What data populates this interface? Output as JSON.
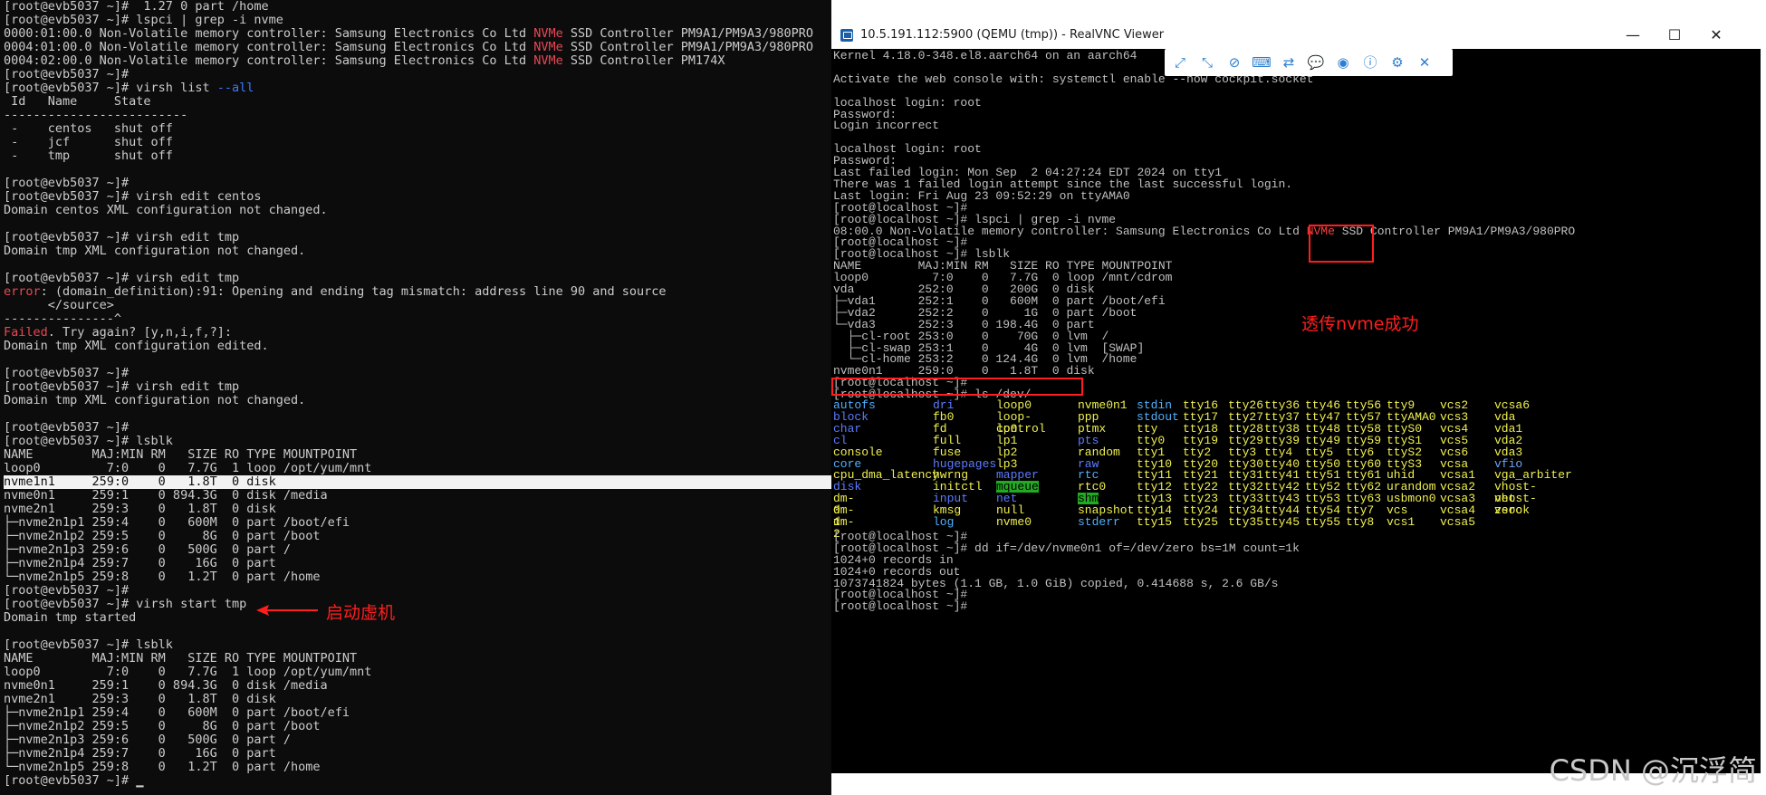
{
  "left_terminal": {
    "lines": [
      {
        "text": "[root@evb5037 ~]#  1.27 0 part /home"
      },
      {
        "text": "[root@evb5037 ~]# lspci | grep -i nvme"
      },
      {
        "pre": "0000:01:00.0 Non-Volatile memory controller: Samsung Electronics Co Ltd ",
        "kw": "NVMe",
        "post": " SSD Controller PM9A1/PM9A3/980PRO",
        "kw_color": "red"
      },
      {
        "pre": "0004:01:00.0 Non-Volatile memory controller: Samsung Electronics Co Ltd ",
        "kw": "NVMe",
        "post": " SSD Controller PM9A1/PM9A3/980PRO",
        "kw_color": "red"
      },
      {
        "pre": "0004:02:00.0 Non-Volatile memory controller: Samsung Electronics Co Ltd ",
        "kw": "NVMe",
        "post": " SSD Controller PM174X",
        "kw_color": "red"
      },
      {
        "text": "[root@evb5037 ~]#"
      },
      {
        "pre": "[root@evb5037 ~]# virsh list ",
        "kw": "--all",
        "post": "",
        "kw_color": "blue"
      },
      {
        "text": " Id   Name     State"
      },
      {
        "text": "-------------------------"
      },
      {
        "text": " -    centos   shut off"
      },
      {
        "text": " -    jcf      shut off"
      },
      {
        "text": " -    tmp      shut off"
      },
      {
        "text": ""
      },
      {
        "text": "[root@evb5037 ~]#"
      },
      {
        "text": "[root@evb5037 ~]# virsh edit centos"
      },
      {
        "text": "Domain centos XML configuration not changed."
      },
      {
        "text": ""
      },
      {
        "text": "[root@evb5037 ~]# virsh edit tmp"
      },
      {
        "text": "Domain tmp XML configuration not changed."
      },
      {
        "text": ""
      },
      {
        "text": "[root@evb5037 ~]# virsh edit tmp"
      },
      {
        "pre": "",
        "kw": "error",
        "post": ": (domain_definition):91: Opening and ending tag mismatch: address line 90 and source",
        "kw_color": "red"
      },
      {
        "text": "      </source>"
      },
      {
        "text": "---------------^"
      },
      {
        "pre": "",
        "kw": "Failed",
        "post": ". Try again? [y,n,i,f,?]:",
        "kw_color": "red"
      },
      {
        "text": "Domain tmp XML configuration edited."
      },
      {
        "text": ""
      },
      {
        "text": "[root@evb5037 ~]#"
      },
      {
        "text": "[root@evb5037 ~]# virsh edit tmp"
      },
      {
        "text": "Domain tmp XML configuration not changed."
      },
      {
        "text": ""
      },
      {
        "text": "[root@evb5037 ~]#"
      },
      {
        "text": "[root@evb5037 ~]# lsblk"
      },
      {
        "text": "NAME        MAJ:MIN RM   SIZE RO TYPE MOUNTPOINT"
      },
      {
        "text": "loop0         7:0    0   7.7G  1 loop /opt/yum/mnt"
      },
      {
        "text": "nvme1n1     259:0    0   1.8T  0 disk",
        "highlight": true
      },
      {
        "text": "nvme0n1     259:1    0 894.3G  0 disk /media"
      },
      {
        "text": "nvme2n1     259:3    0   1.8T  0 disk"
      },
      {
        "text": "├─nvme2n1p1 259:4    0   600M  0 part /boot/efi"
      },
      {
        "text": "├─nvme2n1p2 259:5    0     8G  0 part /boot"
      },
      {
        "text": "├─nvme2n1p3 259:6    0   500G  0 part /"
      },
      {
        "text": "├─nvme2n1p4 259:7    0    16G  0 part"
      },
      {
        "text": "└─nvme2n1p5 259:8    0   1.2T  0 part /home"
      },
      {
        "text": "[root@evb5037 ~]#"
      },
      {
        "text": "[root@evb5037 ~]# virsh start tmp"
      },
      {
        "text": "Domain tmp started"
      },
      {
        "text": ""
      },
      {
        "text": "[root@evb5037 ~]# lsblk"
      },
      {
        "text": "NAME        MAJ:MIN RM   SIZE RO TYPE MOUNTPOINT"
      },
      {
        "text": "loop0         7:0    0   7.7G  1 loop /opt/yum/mnt"
      },
      {
        "text": "nvme0n1     259:1    0 894.3G  0 disk /media"
      },
      {
        "text": "nvme2n1     259:3    0   1.8T  0 disk"
      },
      {
        "text": "├─nvme2n1p1 259:4    0   600M  0 part /boot/efi"
      },
      {
        "text": "├─nvme2n1p2 259:5    0     8G  0 part /boot"
      },
      {
        "text": "├─nvme2n1p3 259:6    0   500G  0 part /"
      },
      {
        "text": "├─nvme2n1p4 259:7    0    16G  0 part"
      },
      {
        "text": "└─nvme2n1p5 259:8    0   1.2T  0 part /home"
      },
      {
        "text": "[root@evb5037 ~]# ▁"
      }
    ],
    "annotation_start_vm": "启动虚机"
  },
  "vnc": {
    "window_title": "10.5.191.112:5900 (QEMU (tmp)) - RealVNC Viewer",
    "minimize_glyph": "—",
    "maximize_glyph": "☐",
    "close_glyph": "✕",
    "toolbar": {
      "icons": [
        "expand-icon",
        "fit-icon",
        "pointer-off-icon",
        "ctrl-alt-del-icon",
        "transfer-icon",
        "chat-icon",
        "record-icon",
        "info-icon",
        "settings-icon",
        "close-toolbar-icon"
      ],
      "glyphs": [
        "⤢",
        "⤡",
        "⊘",
        "⌨",
        "⇄",
        "💬",
        "◉",
        "ⓘ",
        "⚙",
        "✕"
      ]
    },
    "screen_lines": [
      {
        "text": "Kernel 4.18.0-348.el8.aarch64 on an aarch64"
      },
      {
        "text": ""
      },
      {
        "text": "Activate the web console with: systemctl enable --now cockpit.socket"
      },
      {
        "text": ""
      },
      {
        "text": "localhost login: root"
      },
      {
        "text": "Password:"
      },
      {
        "text": "Login incorrect"
      },
      {
        "text": ""
      },
      {
        "text": "localhost login: root"
      },
      {
        "text": "Password:"
      },
      {
        "text": "Last failed login: Mon Sep  2 04:27:24 EDT 2024 on tty1"
      },
      {
        "text": "There was 1 failed login attempt since the last successful login."
      },
      {
        "text": "Last login: Fri Aug 23 09:52:29 on ttyAMA0"
      },
      {
        "text": "[root@localhost ~]#"
      },
      {
        "text": "[root@localhost ~]# lspci | grep -i nvme"
      },
      {
        "pre": "08:00.0 Non-Volatile memory controller: Samsung Electronics Co Ltd ",
        "kw": "NVMe",
        "post": " SSD Controller PM9A1/PM9A3/980PRO"
      },
      {
        "text": "[root@localhost ~]#"
      },
      {
        "text": "[root@localhost ~]# lsblk"
      },
      {
        "text": "NAME        MAJ:MIN RM   SIZE RO TYPE MOUNTPOINT"
      },
      {
        "text": "loop0         7:0    0   7.7G  0 loop /mnt/cdrom"
      },
      {
        "text": "vda         252:0    0   200G  0 disk"
      },
      {
        "text": "├─vda1      252:1    0   600M  0 part /boot/efi"
      },
      {
        "text": "├─vda2      252:2    0     1G  0 part /boot"
      },
      {
        "text": "└─vda3      252:3    0 198.4G  0 part"
      },
      {
        "text": "  ├─cl-root 253:0    0    70G  0 lvm  /"
      },
      {
        "text": "  ├─cl-swap 253:1    0     4G  0 lvm  [SWAP]"
      },
      {
        "text": "  └─cl-home 253:2    0 124.4G  0 lvm  /home"
      },
      {
        "text": "nvme0n1     259:0    0   1.8T  0 disk"
      },
      {
        "text": "[root@localhost ~]#"
      },
      {
        "text": "[root@localhost ~]# ls /dev/"
      }
    ],
    "ls_dev": {
      "columns": [
        [
          {
            "t": "autofs",
            "c": "cyan"
          },
          {
            "t": "block",
            "c": "blue"
          },
          {
            "t": "char",
            "c": "blue"
          },
          {
            "t": "cl",
            "c": "blue"
          },
          {
            "t": "console",
            "c": "yellow"
          },
          {
            "t": "core",
            "c": "cyan"
          },
          {
            "t": "cpu_dma_latency",
            "c": "yellow"
          },
          {
            "t": "disk",
            "c": "blue"
          },
          {
            "t": "dm-0",
            "c": "yellow"
          },
          {
            "t": "dm-1",
            "c": "yellow"
          },
          {
            "t": "dm-2",
            "c": "yellow"
          }
        ],
        [
          {
            "t": "dri",
            "c": "blue"
          },
          {
            "t": "fb0",
            "c": "yellow"
          },
          {
            "t": "fd",
            "c": "yellow"
          },
          {
            "t": "full",
            "c": "yellow"
          },
          {
            "t": "fuse",
            "c": "yellow"
          },
          {
            "t": "hugepages",
            "c": "blue"
          },
          {
            "t": "hwrng",
            "c": "yellow"
          },
          {
            "t": "initctl",
            "c": "yellow"
          },
          {
            "t": "input",
            "c": "blue"
          },
          {
            "t": "kmsg",
            "c": "yellow"
          },
          {
            "t": "log",
            "c": "cyan"
          }
        ],
        [
          {
            "t": "loop0",
            "c": "yellow"
          },
          {
            "t": "loop-control",
            "c": "yellow"
          },
          {
            "t": "lp0",
            "c": "yellow"
          },
          {
            "t": "lp1",
            "c": "yellow"
          },
          {
            "t": "lp2",
            "c": "yellow"
          },
          {
            "t": "lp3",
            "c": "yellow"
          },
          {
            "t": "mapper",
            "c": "blue"
          },
          {
            "t": "mqueue",
            "c": "green"
          },
          {
            "t": "net",
            "c": "blue"
          },
          {
            "t": "null",
            "c": "yellow"
          },
          {
            "t": "nvme0",
            "c": "yellow"
          }
        ],
        [
          {
            "t": "nvme0n1",
            "c": "yellow"
          },
          {
            "t": "ppp",
            "c": "yellow"
          },
          {
            "t": "ptmx",
            "c": "yellow"
          },
          {
            "t": "pts",
            "c": "blue"
          },
          {
            "t": "random",
            "c": "yellow"
          },
          {
            "t": "raw",
            "c": "blue"
          },
          {
            "t": "rtc",
            "c": "cyan"
          },
          {
            "t": "rtc0",
            "c": "yellow"
          },
          {
            "t": "shm",
            "c": "green"
          },
          {
            "t": "snapshot",
            "c": "yellow"
          },
          {
            "t": "stderr",
            "c": "cyan"
          }
        ],
        [
          {
            "t": "stdin",
            "c": "cyan"
          },
          {
            "t": "stdout",
            "c": "cyan"
          },
          {
            "t": "tty",
            "c": "yellow"
          },
          {
            "t": "tty0",
            "c": "yellow"
          },
          {
            "t": "tty1",
            "c": "yellow"
          },
          {
            "t": "tty10",
            "c": "yellow"
          },
          {
            "t": "tty11",
            "c": "yellow"
          },
          {
            "t": "tty12",
            "c": "yellow"
          },
          {
            "t": "tty13",
            "c": "yellow"
          },
          {
            "t": "tty14",
            "c": "yellow"
          },
          {
            "t": "tty15",
            "c": "yellow"
          }
        ],
        [
          {
            "t": "tty16",
            "c": "yellow"
          },
          {
            "t": "tty17",
            "c": "yellow"
          },
          {
            "t": "tty18",
            "c": "yellow"
          },
          {
            "t": "tty19",
            "c": "yellow"
          },
          {
            "t": "tty2",
            "c": "yellow"
          },
          {
            "t": "tty20",
            "c": "yellow"
          },
          {
            "t": "tty21",
            "c": "yellow"
          },
          {
            "t": "tty22",
            "c": "yellow"
          },
          {
            "t": "tty23",
            "c": "yellow"
          },
          {
            "t": "tty24",
            "c": "yellow"
          },
          {
            "t": "tty25",
            "c": "yellow"
          }
        ],
        [
          {
            "t": "tty26",
            "c": "yellow"
          },
          {
            "t": "tty27",
            "c": "yellow"
          },
          {
            "t": "tty28",
            "c": "yellow"
          },
          {
            "t": "tty29",
            "c": "yellow"
          },
          {
            "t": "tty3",
            "c": "yellow"
          },
          {
            "t": "tty30",
            "c": "yellow"
          },
          {
            "t": "tty31",
            "c": "yellow"
          },
          {
            "t": "tty32",
            "c": "yellow"
          },
          {
            "t": "tty33",
            "c": "yellow"
          },
          {
            "t": "tty34",
            "c": "yellow"
          },
          {
            "t": "tty35",
            "c": "yellow"
          }
        ],
        [
          {
            "t": "tty36",
            "c": "yellow"
          },
          {
            "t": "tty37",
            "c": "yellow"
          },
          {
            "t": "tty38",
            "c": "yellow"
          },
          {
            "t": "tty39",
            "c": "yellow"
          },
          {
            "t": "tty4",
            "c": "yellow"
          },
          {
            "t": "tty40",
            "c": "yellow"
          },
          {
            "t": "tty41",
            "c": "yellow"
          },
          {
            "t": "tty42",
            "c": "yellow"
          },
          {
            "t": "tty43",
            "c": "yellow"
          },
          {
            "t": "tty44",
            "c": "yellow"
          },
          {
            "t": "tty45",
            "c": "yellow"
          }
        ],
        [
          {
            "t": "tty46",
            "c": "yellow"
          },
          {
            "t": "tty47",
            "c": "yellow"
          },
          {
            "t": "tty48",
            "c": "yellow"
          },
          {
            "t": "tty49",
            "c": "yellow"
          },
          {
            "t": "tty5",
            "c": "yellow"
          },
          {
            "t": "tty50",
            "c": "yellow"
          },
          {
            "t": "tty51",
            "c": "yellow"
          },
          {
            "t": "tty52",
            "c": "yellow"
          },
          {
            "t": "tty53",
            "c": "yellow"
          },
          {
            "t": "tty54",
            "c": "yellow"
          },
          {
            "t": "tty55",
            "c": "yellow"
          }
        ],
        [
          {
            "t": "tty56",
            "c": "yellow"
          },
          {
            "t": "tty57",
            "c": "yellow"
          },
          {
            "t": "tty58",
            "c": "yellow"
          },
          {
            "t": "tty59",
            "c": "yellow"
          },
          {
            "t": "tty6",
            "c": "yellow"
          },
          {
            "t": "tty60",
            "c": "yellow"
          },
          {
            "t": "tty61",
            "c": "yellow"
          },
          {
            "t": "tty62",
            "c": "yellow"
          },
          {
            "t": "tty63",
            "c": "yellow"
          },
          {
            "t": "tty7",
            "c": "yellow"
          },
          {
            "t": "tty8",
            "c": "yellow"
          }
        ],
        [
          {
            "t": "tty9",
            "c": "yellow"
          },
          {
            "t": "ttyAMA0",
            "c": "yellow"
          },
          {
            "t": "ttyS0",
            "c": "yellow"
          },
          {
            "t": "ttyS1",
            "c": "yellow"
          },
          {
            "t": "ttyS2",
            "c": "yellow"
          },
          {
            "t": "ttyS3",
            "c": "yellow"
          },
          {
            "t": "uhid",
            "c": "yellow"
          },
          {
            "t": "urandom",
            "c": "yellow"
          },
          {
            "t": "usbmon0",
            "c": "yellow"
          },
          {
            "t": "vcs",
            "c": "yellow"
          },
          {
            "t": "vcs1",
            "c": "yellow"
          }
        ],
        [
          {
            "t": "vcs2",
            "c": "yellow"
          },
          {
            "t": "vcs3",
            "c": "yellow"
          },
          {
            "t": "vcs4",
            "c": "yellow"
          },
          {
            "t": "vcs5",
            "c": "yellow"
          },
          {
            "t": "vcs6",
            "c": "yellow"
          },
          {
            "t": "vcsa",
            "c": "yellow"
          },
          {
            "t": "vcsa1",
            "c": "yellow"
          },
          {
            "t": "vcsa2",
            "c": "yellow"
          },
          {
            "t": "vcsa3",
            "c": "yellow"
          },
          {
            "t": "vcsa4",
            "c": "yellow"
          },
          {
            "t": "vcsa5",
            "c": "yellow"
          }
        ],
        [
          {
            "t": "vcsa6",
            "c": "yellow"
          },
          {
            "t": "vda",
            "c": "yellow"
          },
          {
            "t": "vda1",
            "c": "yellow"
          },
          {
            "t": "vda2",
            "c": "yellow"
          },
          {
            "t": "vda3",
            "c": "yellow"
          },
          {
            "t": "vfio",
            "c": "lblue"
          },
          {
            "t": "vga_arbiter",
            "c": "yellow"
          },
          {
            "t": "vhost-net",
            "c": "yellow"
          },
          {
            "t": "vhost-vsock",
            "c": "yellow"
          },
          {
            "t": "zero",
            "c": "yellow"
          }
        ]
      ]
    },
    "tail_lines": [
      {
        "text": "[root@localhost ~]#"
      },
      {
        "text": "[root@localhost ~]# dd if=/dev/nvme0n1 of=/dev/zero bs=1M count=1k"
      },
      {
        "text": "1024+0 records in"
      },
      {
        "text": "1024+0 records out"
      },
      {
        "text": "1073741824 bytes (1.1 GB, 1.0 GiB) copied, 0.414688 s, 2.6 GB/s"
      },
      {
        "text": "[root@localhost ~]#"
      },
      {
        "text": "[root@localhost ~]#"
      }
    ],
    "annotation_nvme_ok": "透传nvme成功"
  },
  "watermark": "CSDN @沉浮简",
  "colors": {
    "terminal_bg": "#0c0c0c",
    "vnc_bg": "#000000",
    "annotation": "#ff1e1e",
    "highlight_row": "#f2f2f2"
  }
}
